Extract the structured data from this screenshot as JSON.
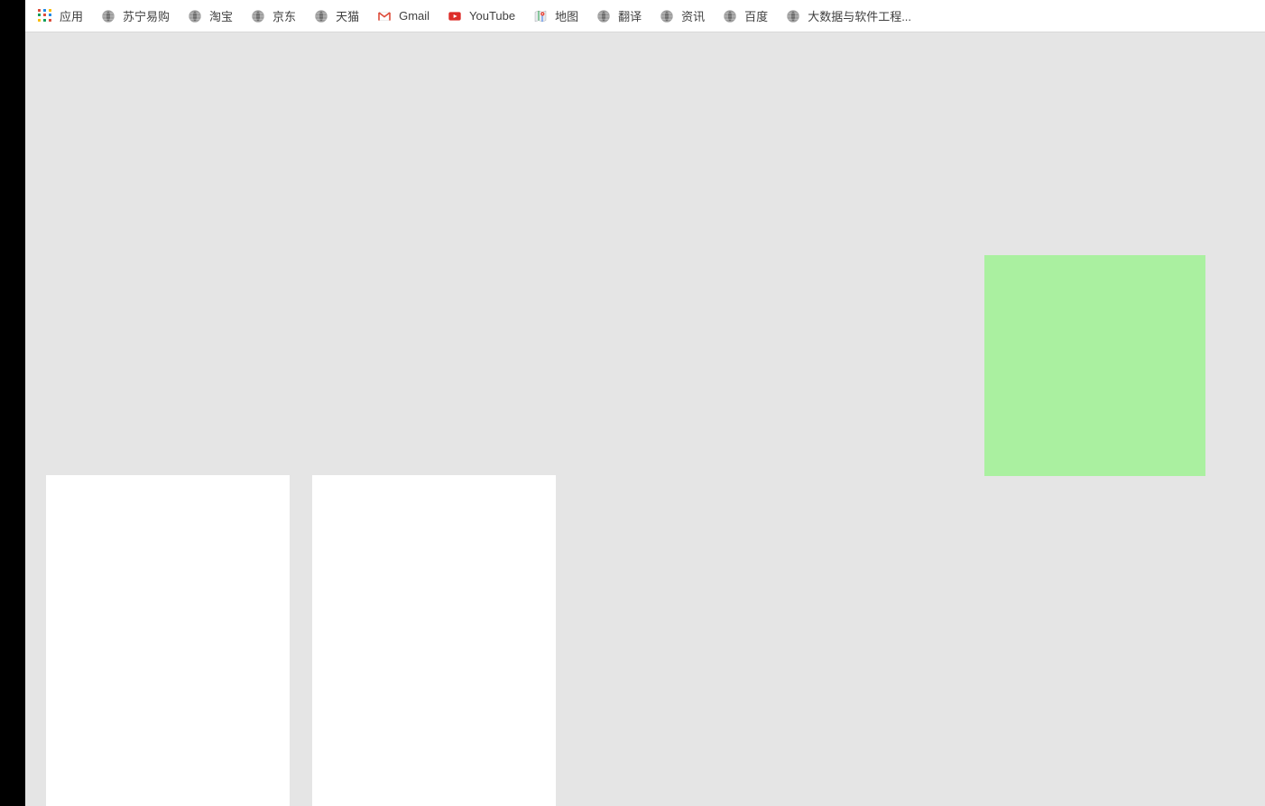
{
  "bookmarks": [
    {
      "label": "应用",
      "icon": "apps-grid",
      "colors": [
        "#dd4b39",
        "#1e88e5",
        "#fbbc04",
        "#0f9d58",
        "#dd4b39",
        "#1e88e5",
        "#fbbc04",
        "#0f9d58",
        "#dd4b39"
      ]
    },
    {
      "label": "苏宁易购",
      "icon": "globe"
    },
    {
      "label": "淘宝",
      "icon": "globe"
    },
    {
      "label": "京东",
      "icon": "globe"
    },
    {
      "label": "天猫",
      "icon": "globe"
    },
    {
      "label": "Gmail",
      "icon": "gmail"
    },
    {
      "label": "YouTube",
      "icon": "youtube"
    },
    {
      "label": "地图",
      "icon": "maps"
    },
    {
      "label": "翻译",
      "icon": "globe"
    },
    {
      "label": "资讯",
      "icon": "globe"
    },
    {
      "label": "百度",
      "icon": "globe"
    },
    {
      "label": "大数据与软件工程...",
      "icon": "globe"
    }
  ],
  "colors": {
    "green_box": "#aaf0a0",
    "content_bg": "#e5e5e5"
  }
}
